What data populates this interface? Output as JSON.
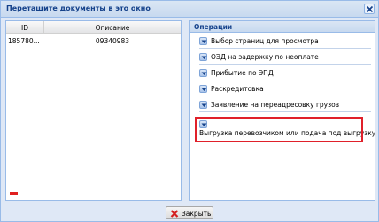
{
  "window": {
    "title": "Перетащите документы в это окно"
  },
  "grid": {
    "columns": [
      "ID",
      "Описание"
    ],
    "rows": [
      {
        "id": "185780...",
        "description": "09340983"
      }
    ]
  },
  "operations": {
    "title": "Операции",
    "items": [
      {
        "label": "Выбор страниц для просмотра"
      },
      {
        "label": "ОЭД на задержку по неоплате"
      },
      {
        "label": "Прибытие по ЭПД"
      },
      {
        "label": "Раскредитовка"
      },
      {
        "label": "Заявление на переадресовку грузов"
      },
      {
        "label": "Выгрузка перевозчиком или подача под выгрузку"
      }
    ]
  },
  "footer": {
    "close_label": "Закрыть"
  },
  "colors": {
    "highlight": "#e0202a",
    "remove": "#e02020",
    "title": "#15428b"
  },
  "icons": [
    "close-icon",
    "dropdown-arrow-icon",
    "minus-icon",
    "red-x-icon"
  ]
}
